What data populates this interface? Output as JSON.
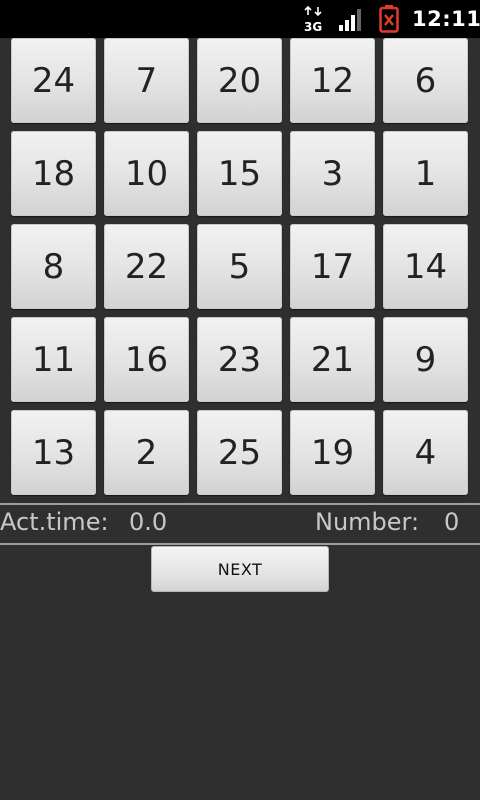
{
  "status_bar": {
    "network_label": "3G",
    "clock": "12:11"
  },
  "grid": {
    "rows": [
      [
        "24",
        "7",
        "20",
        "12",
        "6"
      ],
      [
        "18",
        "10",
        "15",
        "3",
        "1"
      ],
      [
        "8",
        "22",
        "5",
        "17",
        "14"
      ],
      [
        "11",
        "16",
        "23",
        "21",
        "9"
      ],
      [
        "13",
        "2",
        "25",
        "19",
        "4"
      ]
    ]
  },
  "info": {
    "act_time_label": "Act.time:",
    "act_time_value": "0.0",
    "number_label": "Number:",
    "number_value": "0"
  },
  "next_button": {
    "label": "NEXT"
  },
  "colors": {
    "background": "#2f2f2f",
    "tile": "#e3e3e3",
    "text_light": "#c8c8c8"
  }
}
